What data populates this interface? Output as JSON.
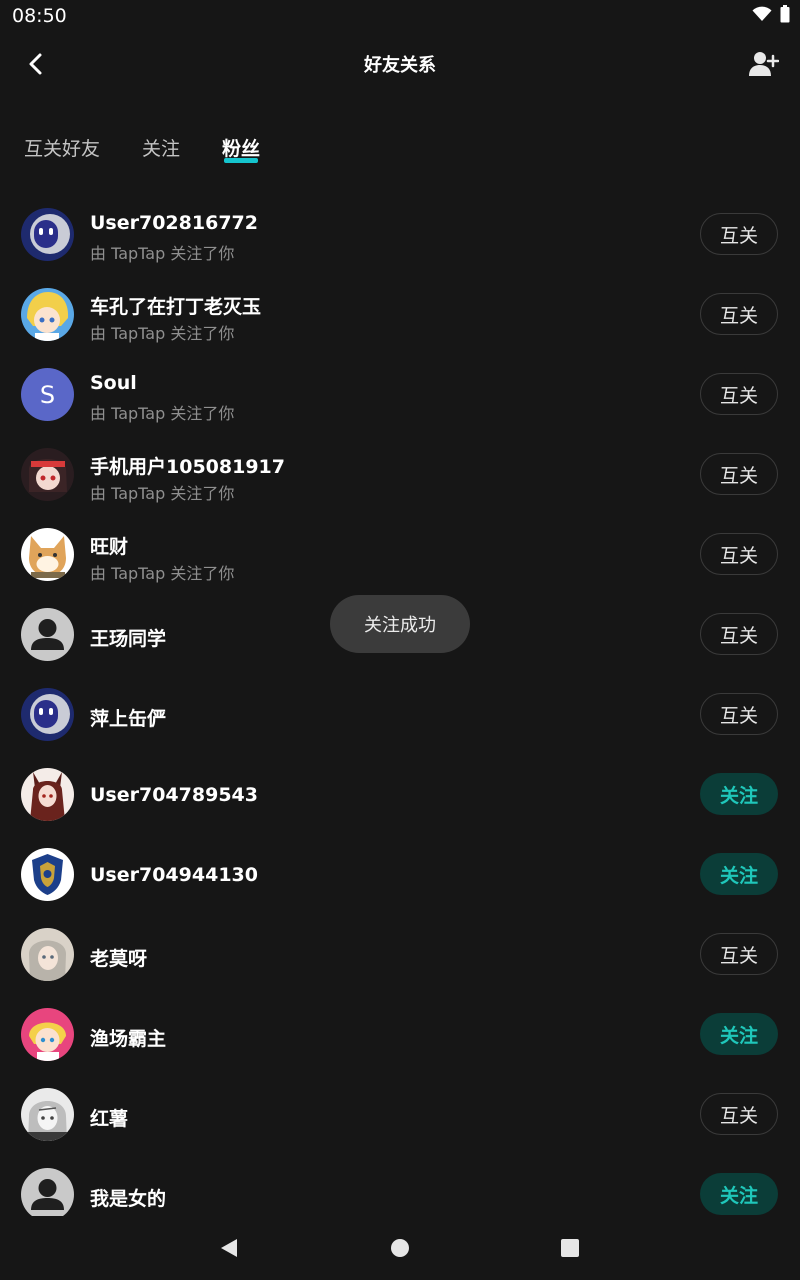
{
  "status_bar": {
    "time": "08:50",
    "icons": [
      "wifi-icon",
      "battery-icon"
    ]
  },
  "header": {
    "title": "好友关系",
    "back_icon": "chevron-left-icon",
    "action_icon": "add-friend-icon"
  },
  "tabs": [
    {
      "label": "互关好友",
      "active": false
    },
    {
      "label": "关注",
      "active": false
    },
    {
      "label": "粉丝",
      "active": true
    }
  ],
  "colors": {
    "background": "#161616",
    "accent": "#15c5ce",
    "follow_bg": "#0b3d38",
    "follow_text": "#1fc7ba",
    "secondary_text": "#8f8f8f"
  },
  "fans": [
    {
      "name": "User702816772",
      "subtitle": "由 TapTap 关注了你",
      "button": "互关",
      "type": "mutual",
      "avatar": "robot-avatar"
    },
    {
      "name": "车孔了在打丁老灭玉",
      "subtitle": "由 TapTap 关注了你",
      "button": "互关",
      "type": "mutual",
      "avatar": "anime-avatar-blonde"
    },
    {
      "name": "Soul",
      "subtitle": "由 TapTap 关注了你",
      "button": "互关",
      "type": "mutual",
      "avatar": "letter-avatar",
      "avatar_letter": "S"
    },
    {
      "name": "手机用户105081917",
      "subtitle": "由 TapTap 关注了你",
      "button": "互关",
      "type": "mutual",
      "avatar": "anime-avatar-dark"
    },
    {
      "name": "旺财",
      "subtitle": "由 TapTap 关注了你",
      "button": "互关",
      "type": "mutual",
      "avatar": "dog-avatar"
    },
    {
      "name": "王玚同学",
      "subtitle": "",
      "button": "互关",
      "type": "mutual",
      "avatar": "default-avatar"
    },
    {
      "name": "萍上缶俨",
      "subtitle": "",
      "button": "互关",
      "type": "mutual",
      "avatar": "robot-avatar"
    },
    {
      "name": "User704789543",
      "subtitle": "",
      "button": "关注",
      "type": "follow",
      "avatar": "anime-avatar-foxgirl"
    },
    {
      "name": "User704944130",
      "subtitle": "",
      "button": "关注",
      "type": "follow",
      "avatar": "crest-avatar"
    },
    {
      "name": "老莫呀",
      "subtitle": "",
      "button": "互关",
      "type": "mutual",
      "avatar": "anime-avatar-silver"
    },
    {
      "name": "渔场霸主",
      "subtitle": "",
      "button": "关注",
      "type": "follow",
      "avatar": "anime-avatar-pink"
    },
    {
      "name": "红薯",
      "subtitle": "",
      "button": "互关",
      "type": "mutual",
      "avatar": "sketch-avatar"
    },
    {
      "name": "我是女的",
      "subtitle": "",
      "button": "关注",
      "type": "follow",
      "avatar": "default-avatar"
    }
  ],
  "toast": "关注成功",
  "nav_bar": {
    "back": "nav-back-icon",
    "home": "nav-home-icon",
    "recents": "nav-recents-icon"
  }
}
